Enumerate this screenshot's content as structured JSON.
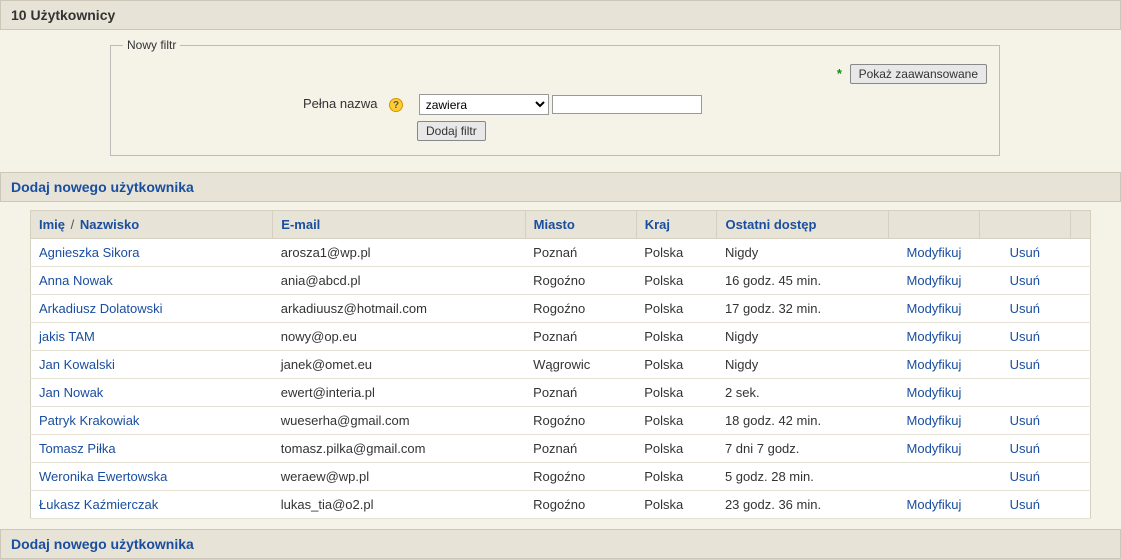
{
  "page": {
    "title": "10 Użytkownicy"
  },
  "filter": {
    "legend": "Nowy filtr",
    "show_advanced": "Pokaż zaawansowane",
    "full_name_label": "Pełna nazwa",
    "operator_selected": "zawiera",
    "value": "",
    "add_filter": "Dodaj filtr"
  },
  "add_user_link": "Dodaj nowego użytkownika",
  "table": {
    "headers": {
      "first": "Imię",
      "sep": "/",
      "last": "Nazwisko",
      "email": "E-mail",
      "city": "Miasto",
      "country": "Kraj",
      "access": "Ostatni dostęp"
    },
    "modify": "Modyfikuj",
    "delete": "Usuń",
    "rows": [
      {
        "name": "Agnieszka Sikora",
        "email": "arosza1@wp.pl",
        "city": "Poznań",
        "country": "Polska",
        "access": "Nigdy",
        "modify": true,
        "del": true
      },
      {
        "name": "Anna Nowak",
        "email": "ania@abcd.pl",
        "city": "Rogoźno",
        "country": "Polska",
        "access": "16 godz. 45 min.",
        "modify": true,
        "del": true
      },
      {
        "name": "Arkadiusz Dolatowski",
        "email": "arkadiuusz@hotmail.com",
        "city": "Rogoźno",
        "country": "Polska",
        "access": "17 godz. 32 min.",
        "modify": true,
        "del": true
      },
      {
        "name": "jakis TAM",
        "email": "nowy@op.eu",
        "city": "Poznań",
        "country": "Polska",
        "access": "Nigdy",
        "modify": true,
        "del": true
      },
      {
        "name": "Jan Kowalski",
        "email": "janek@omet.eu",
        "city": "Wągrowic",
        "country": "Polska",
        "access": "Nigdy",
        "modify": true,
        "del": true
      },
      {
        "name": "Jan Nowak",
        "email": "ewert@interia.pl",
        "city": "Poznań",
        "country": "Polska",
        "access": "2 sek.",
        "modify": true,
        "del": false
      },
      {
        "name": "Patryk Krakowiak",
        "email": "wueserha@gmail.com",
        "city": "Rogoźno",
        "country": "Polska",
        "access": "18 godz. 42 min.",
        "modify": true,
        "del": true
      },
      {
        "name": "Tomasz Piłka",
        "email": "tomasz.pilka@gmail.com",
        "city": "Poznań",
        "country": "Polska",
        "access": "7 dni 7 godz.",
        "modify": true,
        "del": true
      },
      {
        "name": "Weronika Ewertowska",
        "email": "weraew@wp.pl",
        "city": "Rogoźno",
        "country": "Polska",
        "access": "5 godz. 28 min.",
        "modify": false,
        "del": true
      },
      {
        "name": "Łukasz Kaźmierczak",
        "email": "lukas_tia@o2.pl",
        "city": "Rogoźno",
        "country": "Polska",
        "access": "23 godz. 36 min.",
        "modify": true,
        "del": true
      }
    ]
  }
}
